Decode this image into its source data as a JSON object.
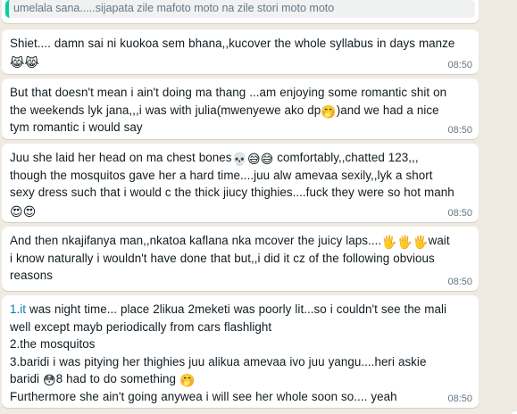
{
  "colors": {
    "chat_background": "#efeae2",
    "bubble": "#ffffff",
    "text": "#111b21",
    "meta": "#667781",
    "quote_bar": "#06cf9c",
    "quote_background": "#f0f2f1",
    "link": "#027eb5"
  },
  "quoted": {
    "text": "umelala sana.....sijapata zile mafoto moto na zile stori moto moto"
  },
  "messages": [
    {
      "lines": [
        "Shiet.... damn sai ni kuokoa sem bhana,,kucover the whole syllabus in days manze"
      ],
      "emoji": "crying-cat-face x2",
      "time": "08:50"
    },
    {
      "lines": [
        "But that doesn't mean i ain't doing ma thang ...am enjoying some romantic shit on",
        "the weekends lyk jana,,,i was with julia(mwenyewe ako dp",
        ")and we had a nice",
        "tym romantic i would say"
      ],
      "time": "08:50"
    },
    {
      "lines": [
        "Juu she laid her head on ma chest bones",
        " comfortably,,chatted 123,,,",
        "though the mosquitos gave her a hard time....juu alw amevaa sexily,,lyk a short",
        "sexy dress such that i would c the thick jiucy thighies....fuck they were so hot manh"
      ],
      "time": "08:50"
    },
    {
      "lines": [
        "And then nkajifanya man,,nkatoa kaflana nka mcover the juicy laps....",
        "wait",
        "i know naturally i wouldn't have done that but,,i did it cz of the following obvious",
        "reasons"
      ],
      "time": "08:50"
    },
    {
      "lines": [
        "1.it",
        " was night time... place 2likua 2meketi was poorly lit...so i couldn't see the mali",
        "well except mayb periodically from cars flashlight",
        "2.the mosquitos",
        "3.baridi i was pitying her thighies juu alikua amevaa ivo juu yangu....heri askie",
        "baridi ",
        "8 had to do something ",
        "Furthermore she ain't going anywea i will see her whole soon so.... yeah"
      ],
      "time": "08:50"
    }
  ]
}
